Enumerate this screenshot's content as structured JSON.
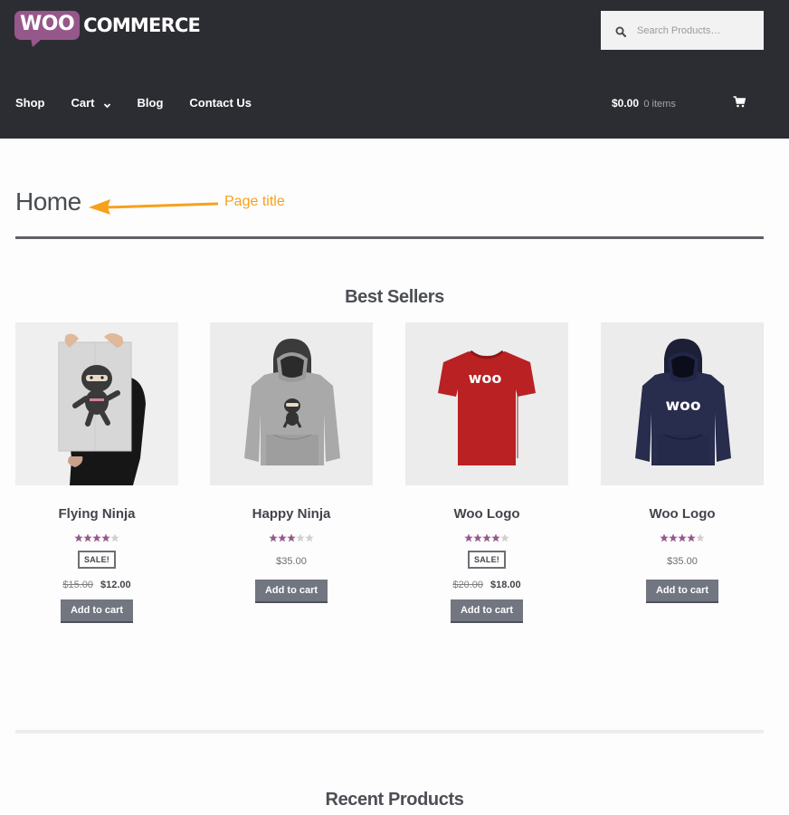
{
  "header": {
    "logo": {
      "woo": "WOO",
      "commerce": "COMMERCE"
    },
    "search": {
      "placeholder": "Search Products…",
      "icon": "search-icon"
    },
    "nav": [
      {
        "label": "Shop"
      },
      {
        "label": "Cart",
        "has_dropdown": true
      },
      {
        "label": "Blog"
      },
      {
        "label": "Contact Us"
      }
    ],
    "cart": {
      "total": "$0.00",
      "items": "0 items",
      "icon": "cart-icon"
    }
  },
  "page": {
    "title": "Home",
    "annotation": "Page title"
  },
  "best_sellers": {
    "title": "Best Sellers",
    "products": [
      {
        "name": "Flying Ninja",
        "rating": 4,
        "sale": true,
        "sale_label": "SALE!",
        "old_price": "$15.00",
        "price": "$12.00",
        "button": "Add to cart",
        "image": "poster"
      },
      {
        "name": "Happy Ninja",
        "rating": 3,
        "sale": false,
        "price": "$35.00",
        "button": "Add to cart",
        "image": "hoodie-grey"
      },
      {
        "name": "Woo Logo",
        "rating": 4,
        "sale": true,
        "sale_label": "SALE!",
        "old_price": "$20.00",
        "price": "$18.00",
        "button": "Add to cart",
        "image": "tshirt-red"
      },
      {
        "name": "Woo Logo",
        "rating": 4,
        "sale": false,
        "price": "$35.00",
        "button": "Add to cart",
        "image": "hoodie-navy"
      }
    ]
  },
  "recent_products": {
    "title": "Recent Products"
  },
  "colors": {
    "header_bg": "#2c2d33",
    "brand_purple": "#96588a",
    "annotation_orange": "#f7a11b",
    "button_bg": "#717680",
    "star_filled": "#96588a",
    "star_empty": "#cfcfcf"
  }
}
